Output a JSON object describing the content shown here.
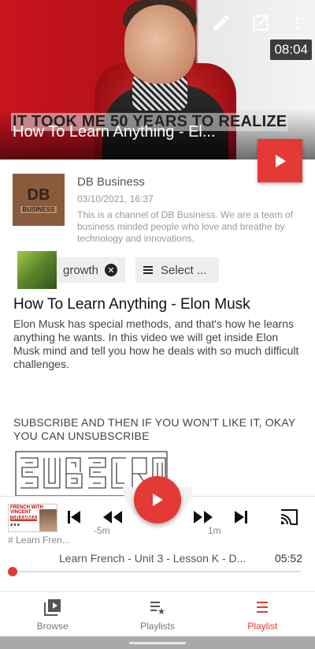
{
  "hero": {
    "banner_text": "IT TOOK ME 50 YEARS TO REALIZE",
    "title": "How To Learn Anything - El...",
    "duration": "08:04",
    "icons": [
      "pencil-icon",
      "open-external-icon",
      "more-vert-icon"
    ]
  },
  "channel": {
    "logo_text": "DB",
    "logo_sub": "BUSINESS",
    "name": "DB Business",
    "date": "03/10/2021, 16:37",
    "description": "This is a channel of DB Business. We are a team of business minded people who love and breathe by technology and innovations,"
  },
  "chips": {
    "tag_label": "growth",
    "select_label": "Select ..."
  },
  "video": {
    "title": "How To Learn Anything - Elon Musk",
    "description": "Elon Musk has special methods, and that's how he learns anything he wants. In this video we will get inside Elon Musk mind and tell you how he deals with so much difficult challenges.",
    "subscribe_text": "SUBSCRIBE AND THEN IF YOU WON'T LIKE IT, OKAY YOU CAN UNSUBSCRIBE"
  },
  "player": {
    "thumb_top": "FRENCH WITH VINCENT",
    "thumb_grammar": "GRAMMAR",
    "playlist_tag": "# Learn Fren...",
    "rewind_label": "-5m",
    "forward_label": "1m",
    "track_title": "Learn French - Unit 3 - Lesson K - D...",
    "track_time": "05:52",
    "progress": 0.0
  },
  "nav": {
    "items": [
      {
        "label": "Browse",
        "icon": "browse-icon"
      },
      {
        "label": "Playlists",
        "icon": "playlists-icon"
      },
      {
        "label": "Playlist",
        "icon": "playlist-icon"
      }
    ],
    "active": "Playlist"
  },
  "colors": {
    "accent": "#e53935"
  }
}
